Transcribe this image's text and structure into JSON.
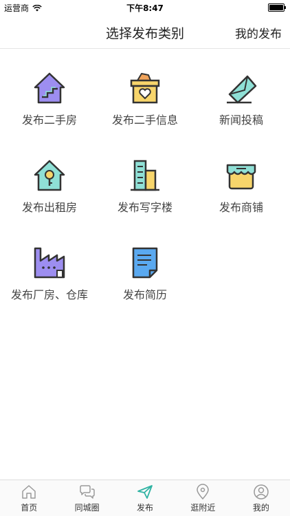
{
  "status": {
    "carrier": "运营商",
    "time": "下午8:47"
  },
  "nav": {
    "title": "选择发布类别",
    "right_label": "我的发布"
  },
  "categories": [
    {
      "label": "发布二手房",
      "icon": "house-stairs-icon"
    },
    {
      "label": "发布二手信息",
      "icon": "box-heart-icon"
    },
    {
      "label": "新闻投稿",
      "icon": "envelope-icon"
    },
    {
      "label": "发布出租房",
      "icon": "house-key-icon"
    },
    {
      "label": "发布写字楼",
      "icon": "office-building-icon"
    },
    {
      "label": "发布商铺",
      "icon": "shop-icon"
    },
    {
      "label": "发布厂房、仓库",
      "icon": "factory-icon"
    },
    {
      "label": "发布简历",
      "icon": "resume-document-icon"
    }
  ],
  "tabs": [
    {
      "label": "首页",
      "icon": "home-icon"
    },
    {
      "label": "同城圈",
      "icon": "chat-icon"
    },
    {
      "label": "发布",
      "icon": "paper-plane-icon",
      "active": true
    },
    {
      "label": "逛附近",
      "icon": "location-pin-icon"
    },
    {
      "label": "我的",
      "icon": "user-icon"
    }
  ],
  "colors": {
    "accent": "#2fb3a3",
    "purple": "#9d8ef0",
    "yellow": "#f7d56b",
    "teal": "#8fe0d6",
    "blue": "#5aa9f0"
  }
}
